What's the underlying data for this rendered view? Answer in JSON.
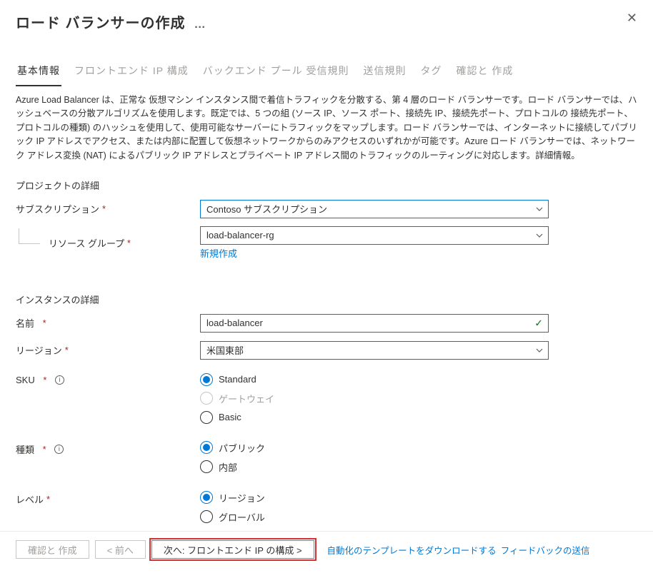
{
  "header": {
    "title": "ロード バランサーの作成",
    "ellipsis": "…"
  },
  "tabs": [
    {
      "id": "basics",
      "label": "基本情報",
      "active": true
    },
    {
      "id": "frontend",
      "label": "フロントエンド IP 構成"
    },
    {
      "id": "backend",
      "label": "バックエンド プール 受信規則"
    },
    {
      "id": "outbound",
      "label": "送信規則"
    },
    {
      "id": "tags",
      "label": "タグ"
    },
    {
      "id": "review",
      "label": "確認と 作成"
    }
  ],
  "description": "Azure Load Balancer は、正常な 仮想マシン インスタンス間で着信トラフィックを分散する、第 4 層のロード バランサーです。ロード バランサーでは、ハッシュベースの分散アルゴリズムを使用します。既定では、5 つの組 (ソース IP、ソース ポート、接続先 IP、接続先ポート、プロトコルの 接続先ポート、プロトコルの種類) のハッシュを使用して、使用可能なサーバーにトラフィックをマップします。ロード バランサーでは、インターネットに接続してパブリック IP アドレスでアクセス、または内部に配置して仮想ネットワークからのみアクセスのいずれかが可能です。Azure ロード バランサーでは、ネットワーク アドレス変換 (NAT) によるパブリック IP アドレスとプライベート IP アドレス間のトラフィックのルーティングに対応します。詳細情報。",
  "sections": {
    "project": "プロジェクトの詳細",
    "instance": "インスタンスの詳細"
  },
  "form": {
    "subscription": {
      "label": "サブスクリプション",
      "value": "Contoso サブスクリプション"
    },
    "resource_group": {
      "label": "リソース グループ",
      "value": "load-balancer-rg",
      "new_link": "新規作成"
    },
    "name": {
      "label": "名前",
      "value": "load-balancer"
    },
    "region": {
      "label": "リージョン",
      "value": "米国東部"
    },
    "sku": {
      "label": "SKU",
      "options": [
        {
          "label": "Standard",
          "selected": true
        },
        {
          "label": "ゲートウェイ",
          "disabled": true
        },
        {
          "label": "Basic"
        }
      ]
    },
    "type": {
      "label": "種類",
      "options": [
        {
          "label": "パブリック",
          "selected": true
        },
        {
          "label": "内部"
        }
      ]
    },
    "tier": {
      "label": "レベル",
      "options": [
        {
          "label": "リージョン",
          "selected": true
        },
        {
          "label": "グローバル"
        }
      ]
    }
  },
  "footer": {
    "review_create": "確認と 作成",
    "previous": "< 前へ",
    "next": "次へ:  フロントエンド IP の構成  >",
    "link_download": "自動化のテンプレートをダウンロードする",
    "link_feedback": "フィードバックの送信"
  }
}
